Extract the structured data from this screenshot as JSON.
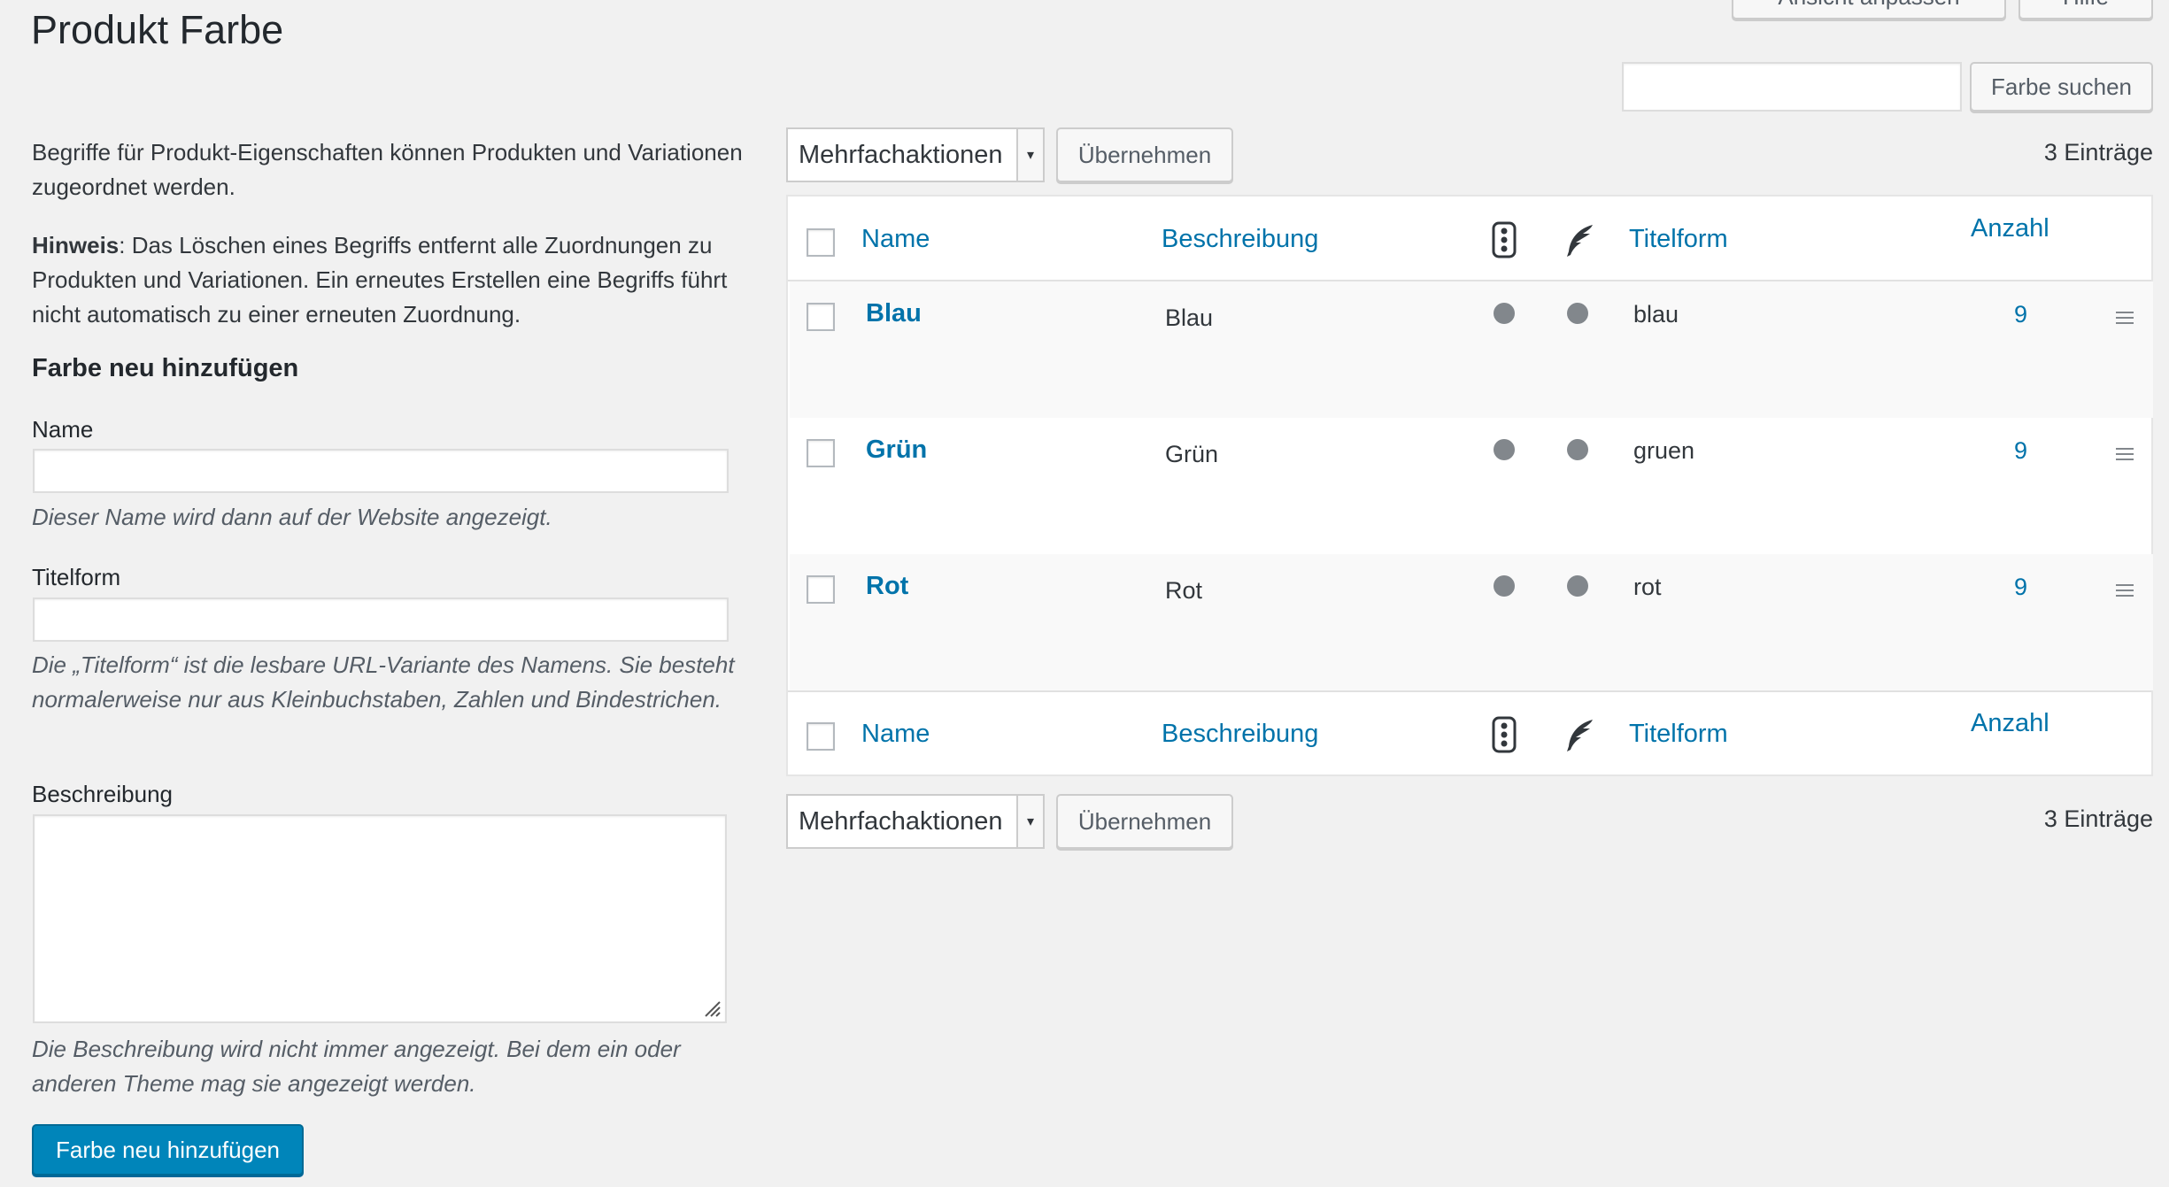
{
  "page": {
    "title": "Produkt Farbe",
    "top_buttons": [
      "Ansicht anpassen",
      "Hilfe"
    ]
  },
  "search": {
    "value": "",
    "button_label": "Farbe suchen"
  },
  "intro": {
    "text": "Begriffe für Produkt-Eigenschaften können Produkten und Variationen zugeordnet werden.",
    "note_bold": "Hinweis",
    "note_text": ": Das Löschen eines Begriffs entfernt alle Zuordnungen zu Produkten und Variationen. Ein erneutes Erstellen eine Begriffs führt nicht automatisch zu einer erneuten Zuordnung."
  },
  "form": {
    "heading": "Farbe neu hinzufügen",
    "name_label": "Name",
    "name_value": "",
    "name_hint": "Dieser Name wird dann auf der Website angezeigt.",
    "slug_label": "Titelform",
    "slug_value": "",
    "slug_hint": "Die „Titelform“ ist die lesbare URL-Variante des Namens. Sie besteht normalerweise nur aus Kleinbuchstaben, Zahlen und Bindestrichen.",
    "desc_label": "Beschreibung",
    "desc_value": "",
    "desc_hint": "Die Beschreibung wird nicht immer angezeigt. Bei dem ein oder anderen Theme mag sie angezeigt werden.",
    "submit_label": "Farbe neu hinzufügen"
  },
  "bulk": {
    "select_value": "Mehrfachaktionen",
    "apply_label": "Übernehmen",
    "count_text": "3 Einträge"
  },
  "table": {
    "columns": {
      "name": "Name",
      "description": "Beschreibung",
      "slug": "Titelform",
      "count": "Anzahl"
    },
    "column_icons": [
      "traffic-light-icon",
      "feather-icon"
    ],
    "rows": [
      {
        "name": "Blau",
        "description": "Blau",
        "slug": "blau",
        "count": "9"
      },
      {
        "name": "Grün",
        "description": "Grün",
        "slug": "gruen",
        "count": "9"
      },
      {
        "name": "Rot",
        "description": "Rot",
        "slug": "rot",
        "count": "9"
      }
    ]
  },
  "colors": {
    "link": "#0073aa",
    "primary": "#0085ba",
    "background": "#f1f1f1"
  }
}
